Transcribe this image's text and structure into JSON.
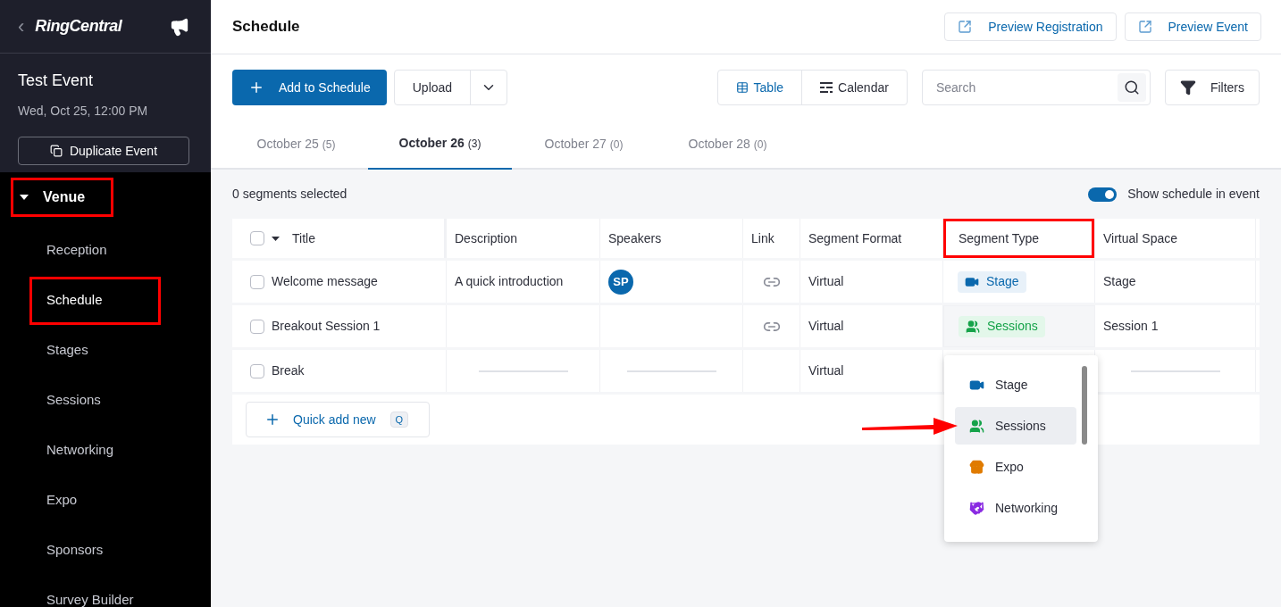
{
  "sidebar": {
    "back": "‹",
    "logo": "RingCentral",
    "event_title": "Test Event",
    "event_date": "Wed, Oct 25, 12:00 PM",
    "duplicate_button": "Duplicate Event",
    "section": {
      "label": "Venue",
      "expanded": true,
      "highlighted": true,
      "children": [
        {
          "label": "Reception",
          "selected": false,
          "highlighted": false
        },
        {
          "label": "Schedule",
          "selected": true,
          "highlighted": true
        },
        {
          "label": "Stages",
          "selected": false,
          "highlighted": false
        },
        {
          "label": "Sessions",
          "selected": false,
          "highlighted": false
        },
        {
          "label": "Networking",
          "selected": false,
          "highlighted": false
        },
        {
          "label": "Expo",
          "selected": false,
          "highlighted": false
        },
        {
          "label": "Sponsors",
          "selected": false,
          "highlighted": false
        },
        {
          "label": "Survey Builder",
          "selected": false,
          "highlighted": false
        }
      ]
    }
  },
  "header": {
    "title": "Schedule",
    "buttons": [
      "Preview Registration",
      "Preview Event"
    ]
  },
  "toolbar": {
    "add_button": "Add to Schedule",
    "upload_button": "Upload",
    "views": [
      {
        "label": "Table",
        "kind": "table",
        "selected": true
      },
      {
        "label": "Calendar",
        "kind": "calendar",
        "selected": false
      }
    ],
    "search": {
      "placeholder": "Search"
    },
    "filters_button": "Filters"
  },
  "date_tabs": [
    {
      "label": "October 25",
      "count": "(5)",
      "selected": false
    },
    {
      "label": "October 26",
      "count": "(3)",
      "selected": true
    },
    {
      "label": "October 27",
      "count": "(0)",
      "selected": false
    },
    {
      "label": "October 28",
      "count": "(0)",
      "selected": false
    }
  ],
  "selection_status": "0 segments selected",
  "show_schedule_toggle": {
    "label": "Show schedule in event",
    "on": true
  },
  "table": {
    "all_checked": false,
    "columns": [
      {
        "label": "Title",
        "highlighted": false
      },
      {
        "label": "Description",
        "highlighted": false
      },
      {
        "label": "Speakers",
        "highlighted": false
      },
      {
        "label": "Link",
        "highlighted": false
      },
      {
        "label": "Segment Format",
        "highlighted": false
      },
      {
        "label": "Segment Type",
        "highlighted": true
      },
      {
        "label": "Virtual Space",
        "highlighted": false
      }
    ],
    "rows": [
      {
        "checked": false,
        "cells": [
          {
            "kind": "text",
            "text": "Welcome message"
          },
          {
            "kind": "text",
            "text": "A quick introduction"
          },
          {
            "kind": "avatar",
            "text": "SP"
          },
          {
            "kind": "link"
          },
          {
            "kind": "text",
            "text": "Virtual"
          },
          {
            "kind": "stage",
            "text": "Stage",
            "active": false
          },
          {
            "kind": "text",
            "text": "Stage"
          }
        ]
      },
      {
        "checked": false,
        "cells": [
          {
            "kind": "text",
            "text": "Breakout Session 1"
          },
          {
            "kind": "blank"
          },
          {
            "kind": "blank"
          },
          {
            "kind": "link"
          },
          {
            "kind": "text",
            "text": "Virtual"
          },
          {
            "kind": "sessions",
            "text": "Sessions",
            "active": true
          },
          {
            "kind": "text",
            "text": "Session 1"
          }
        ]
      },
      {
        "checked": false,
        "cells": [
          {
            "kind": "text",
            "text": "Break"
          },
          {
            "kind": "dash"
          },
          {
            "kind": "dash"
          },
          {
            "kind": "blank"
          },
          {
            "kind": "text",
            "text": "Virtual"
          },
          {
            "kind": "blank"
          },
          {
            "kind": "dash"
          }
        ]
      }
    ],
    "quick_add": {
      "label": "Quick add new",
      "shortcut": "Q"
    }
  },
  "segment_type_menu": {
    "items": [
      {
        "kind": "stage",
        "label": "Stage",
        "selected": false,
        "pointed": false
      },
      {
        "kind": "sessions",
        "label": "Sessions",
        "selected": true,
        "pointed": true
      },
      {
        "kind": "expo",
        "label": "Expo",
        "selected": false,
        "pointed": false
      },
      {
        "kind": "networking",
        "label": "Networking",
        "selected": false,
        "pointed": false
      }
    ]
  }
}
